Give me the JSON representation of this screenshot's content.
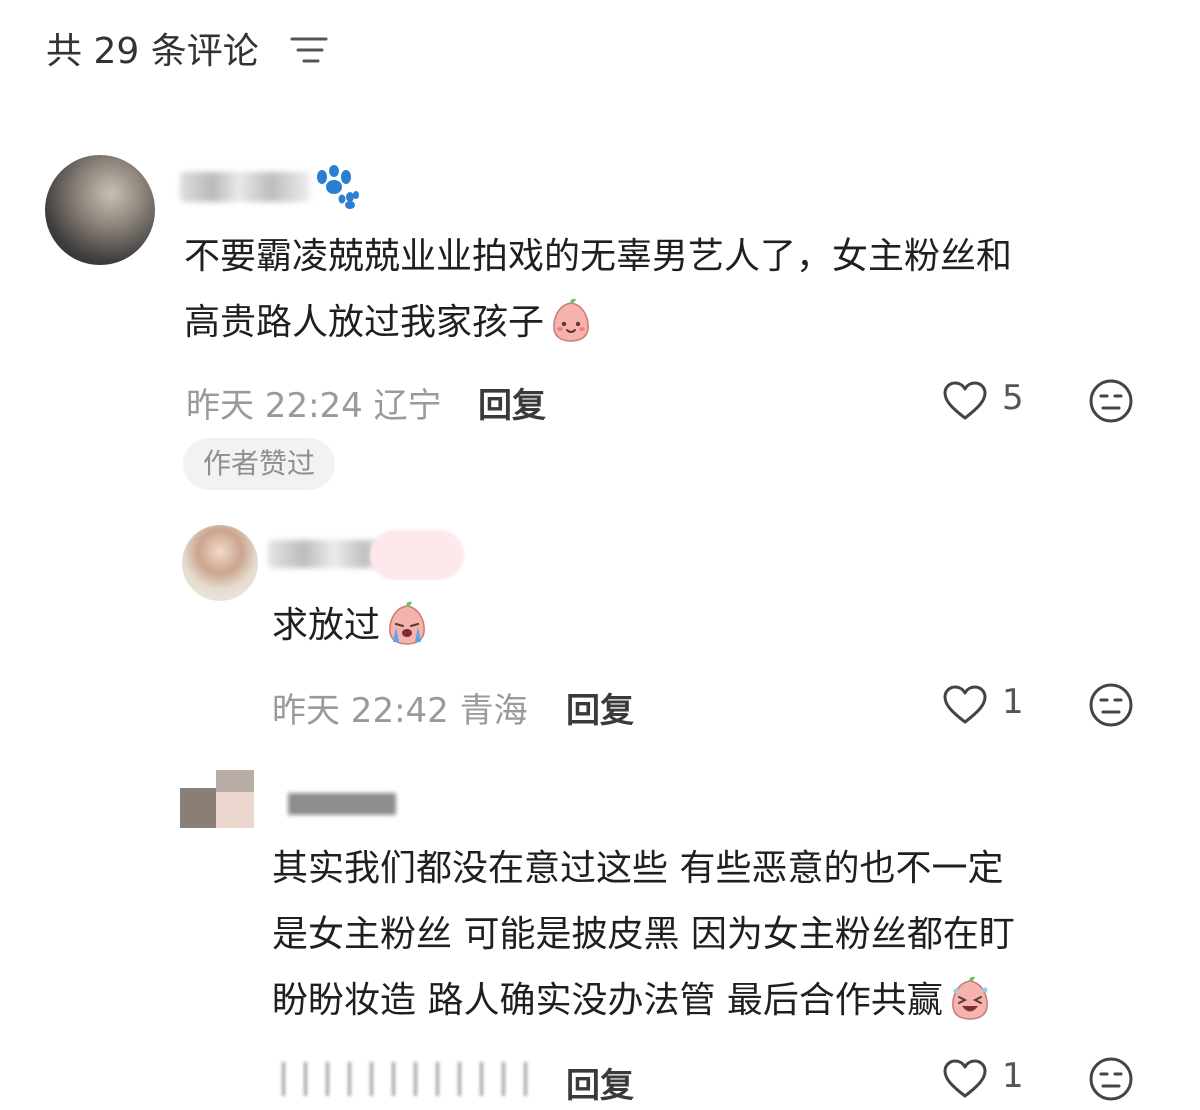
{
  "header": {
    "title": "共 29 条评论",
    "sort_icon": "sort-lines-icon"
  },
  "comments": [
    {
      "avatar": "user-avatar-photo",
      "badge_icon": "paw-icon",
      "text_lines": [
        "不要霸凌兢兢业业拍戏的无辜男艺人了，女主粉丝和",
        "高贵路人放过我家孩子"
      ],
      "emoji": "peach-smile-emoji",
      "time": "昨天 22:24",
      "location": "辽宁",
      "reply_label": "回复",
      "likes": "5",
      "author_badge": "作者赞过"
    },
    {
      "avatar": "user-avatar-photo",
      "text_lines": [
        "求放过"
      ],
      "emoji": "peach-crying-emoji",
      "time": "昨天 22:42",
      "location": "青海",
      "reply_label": "回复",
      "likes": "1"
    },
    {
      "avatar": "pixel-avatar",
      "text_lines": [
        "其实我们都没在意过这些 有些恶意的也不一定",
        "是女主粉丝  可能是披皮黑 因为女主粉丝都在盯",
        "盼盼妆造 路人确实没办法管 最后合作共赢"
      ],
      "emoji": "peach-laughing-emoji",
      "reply_label": "回复",
      "likes": "1"
    }
  ],
  "colors": {
    "text": "#1f1f1f",
    "meta": "#9a9a9a",
    "badge_bg": "#f2f2f2",
    "paw": "#2a7fd4",
    "peach": "#f6b3ad"
  }
}
